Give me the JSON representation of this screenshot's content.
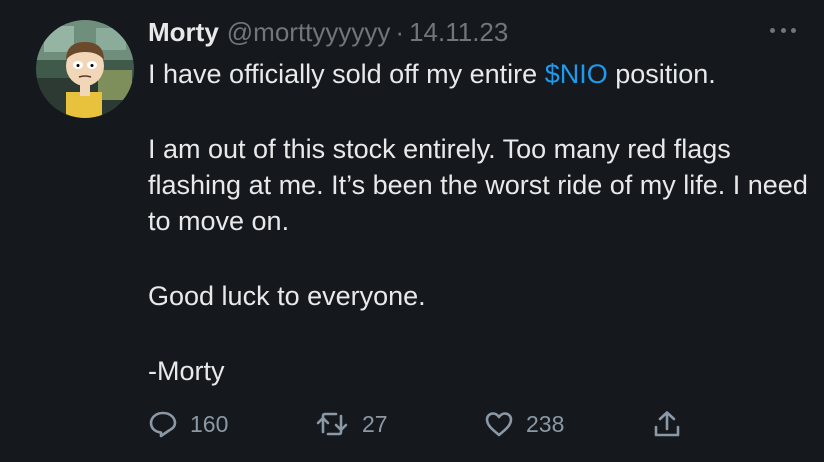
{
  "tweet": {
    "author_name": "Morty",
    "handle": "@morttyyyyyy",
    "separator": "·",
    "date": "14.11.23",
    "lines": {
      "line1_pre": "I have officially sold off my entire ",
      "cashtag": "$NIO",
      "line1_post": " position.",
      "para2": "I am out of this stock entirely. Too many red flags flashing at me. It’s been the worst ride of my life. I need to move on.",
      "para3": "Good luck to everyone.",
      "para4": "-Morty"
    },
    "stats": {
      "replies": "160",
      "retweets": "27",
      "likes": "238"
    }
  },
  "icons": {
    "more": "more-horizontal-icon",
    "reply": "reply-bubble-icon",
    "retweet": "retweet-arrows-icon",
    "like": "heart-icon",
    "share": "share-upload-icon"
  },
  "colors": {
    "background": "#15181c",
    "text": "#e7e9ea",
    "muted": "#71767b",
    "link": "#1d9bf0"
  }
}
